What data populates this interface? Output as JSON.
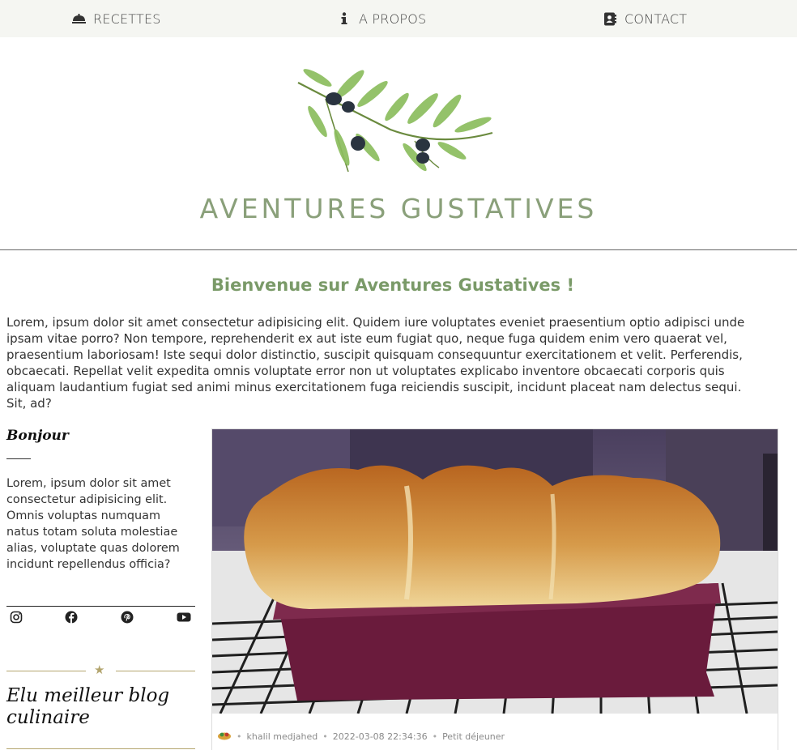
{
  "nav": {
    "items": [
      {
        "label": "RECETTES",
        "icon": "cloche-icon"
      },
      {
        "label": "A PROPOS",
        "icon": "info-icon"
      },
      {
        "label": "CONTACT",
        "icon": "address-book-icon"
      }
    ]
  },
  "header": {
    "title": "AVENTURES GUSTATIVES",
    "logo_icon": "olive-branch-icon"
  },
  "main": {
    "welcome": "Bienvenue sur Aventures Gustatives !",
    "intro": "Lorem, ipsum dolor sit amet consectetur adipisicing elit. Quidem iure voluptates eveniet praesentium optio adipisci unde ipsam vitae porro? Non tempore, reprehenderit ex aut iste eum fugiat quo, neque fuga quidem enim vero quaerat vel, praesentium laboriosam! Iste sequi dolor distinctio, suscipit quisquam consequuntur exercitationem et velit. Perferendis, obcaecati. Repellat velit expedita omnis voluptate error non ut voluptates explicabo inventore obcaecati corporis quis aliquam laudantium fugiat sed animi minus exercitationem fuga reiciendis suscipit, incidunt placeat nam delectus sequi. Sit, ad?"
  },
  "sidebar": {
    "greeting": "Bonjour",
    "text": "Lorem, ipsum dolor sit amet consectetur adipisicing elit. Omnis voluptas numquam natus totam soluta molestiae alias, voluptate quas dolorem incidunt repellendus officia?",
    "social": [
      "instagram-icon",
      "facebook-icon",
      "pinterest-icon",
      "youtube-icon"
    ],
    "star": "★",
    "award": "Elu meilleur blog culinaire"
  },
  "post": {
    "author": "khalil medjahed",
    "date": "2022-03-08 22:34:36",
    "category": "Petit déjeuner",
    "separator": "•"
  },
  "colors": {
    "accent": "#8aa07a",
    "gold": "#b3a56e",
    "nav_bg": "#f5f6f2"
  }
}
